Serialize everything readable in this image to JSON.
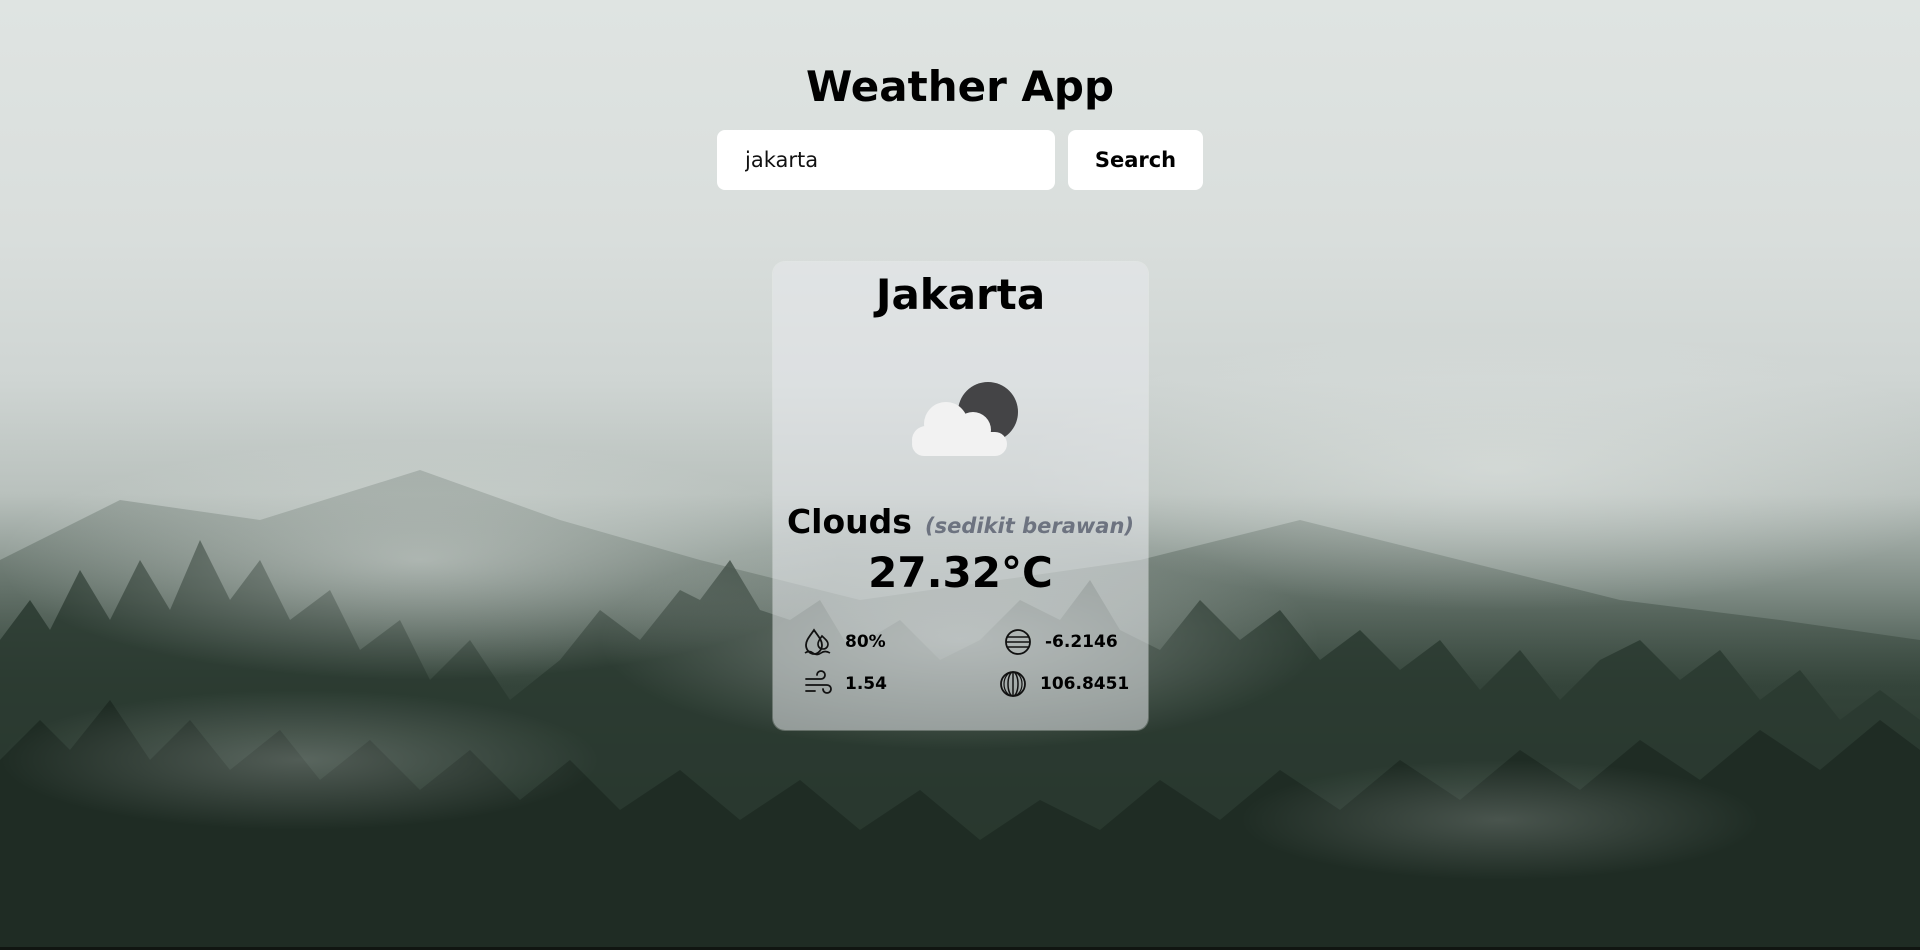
{
  "app": {
    "title": "Weather App"
  },
  "search": {
    "value": "jakarta",
    "button_label": "Search"
  },
  "weather": {
    "city": "Jakarta",
    "icon": "cloud-moon-icon",
    "condition": "Clouds",
    "description": "(sedikit berawan)",
    "temperature": "27.32°C",
    "stats": {
      "humidity": {
        "icon": "humidity-icon",
        "value": "80%"
      },
      "wind": {
        "icon": "wind-icon",
        "value": "1.54"
      },
      "latitude": {
        "icon": "latitude-globe-icon",
        "value": "-6.2146"
      },
      "longitude": {
        "icon": "longitude-globe-icon",
        "value": "106.8451"
      }
    }
  },
  "colors": {
    "card_background": "#e8eaec",
    "description_text": "#6d7380",
    "forest_dark": "#1d2a22",
    "fog_light": "#dfe4e2"
  }
}
